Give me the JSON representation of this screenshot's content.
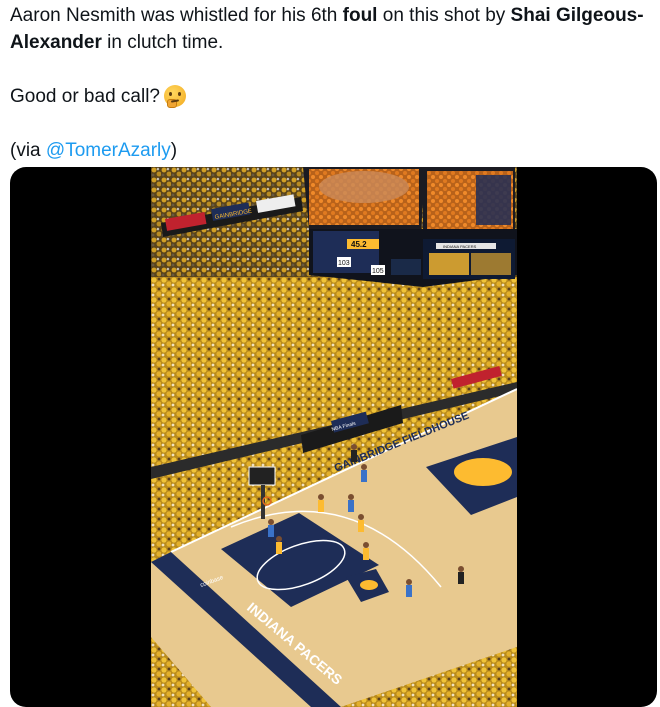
{
  "tweet": {
    "line1_a": "Aaron Nesmith was whistled for his 6th ",
    "line1_bold": "foul",
    "line1_b": " on this shot by ",
    "line1_name": "Shai Gilgeous-",
    "line2_name": "Alexander",
    "line2_rest": " in clutch time.",
    "question": "Good or bad call?",
    "via_open": "(via ",
    "via_handle": "@TomerAzarly",
    "via_close": ")",
    "emoji": "thinking-face-emoji"
  },
  "media": {
    "scoreboard": {
      "clock": "45.2",
      "home_score": "103",
      "away_score": "105",
      "ribbon": "INDIANA PACERS"
    },
    "court": {
      "baseline_text": "GAINBRIDGE FIELDHOUSE",
      "sideline_text": "INDIANA PACERS",
      "sponsor_text": "coinbase"
    },
    "signs": {
      "gainbridge": "GAINBRIDGE",
      "finals": "NBA Finals"
    },
    "colors": {
      "court_wood": "#e8c98f",
      "paint_navy": "#1e2d57",
      "pacers_gold": "#fdbb30",
      "crowd_gold": "#d9a623"
    }
  }
}
